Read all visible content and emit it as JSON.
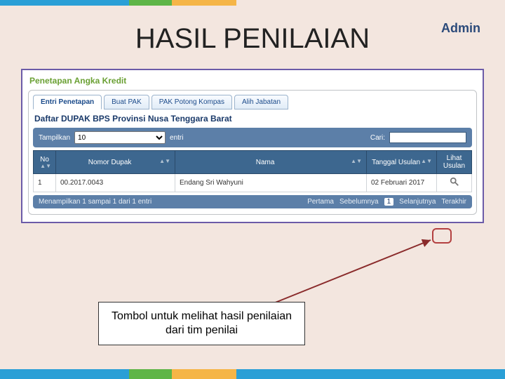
{
  "slide": {
    "title": "HASIL PENILAIAN",
    "role": "Admin",
    "callout_line1": "Tombol untuk melihat hasil penilaian",
    "callout_line2": "dari tim penilai"
  },
  "section": {
    "heading": "Penetapan Angka Kredit",
    "panel_title": "Daftar DUPAK BPS Provinsi Nusa Tenggara Barat"
  },
  "tabs": [
    {
      "label": "Entri Penetapan",
      "active": true
    },
    {
      "label": "Buat PAK",
      "active": false
    },
    {
      "label": "PAK Potong Kompas",
      "active": false
    },
    {
      "label": "Alih Jabatan",
      "active": false
    }
  ],
  "controls": {
    "show_label": "Tampilkan",
    "show_value": "10",
    "entries_label": "entri",
    "search_label": "Cari:",
    "search_value": ""
  },
  "columns": {
    "no": "No",
    "nomor": "Nomor Dupak",
    "nama": "Nama",
    "tanggal": "Tanggal Usulan",
    "lihat": "Lihat Usulan"
  },
  "rows": [
    {
      "no": "1",
      "nomor": "00.2017.0043",
      "nama": "Endang Sri Wahyuni",
      "tanggal": "02 Februari 2017"
    }
  ],
  "footer": {
    "info": "Menampilkan 1 sampai 1 dari 1 entri",
    "first": "Pertama",
    "prev": "Sebelumnya",
    "page": "1",
    "next": "Selanjutnya",
    "last": "Terakhir"
  }
}
